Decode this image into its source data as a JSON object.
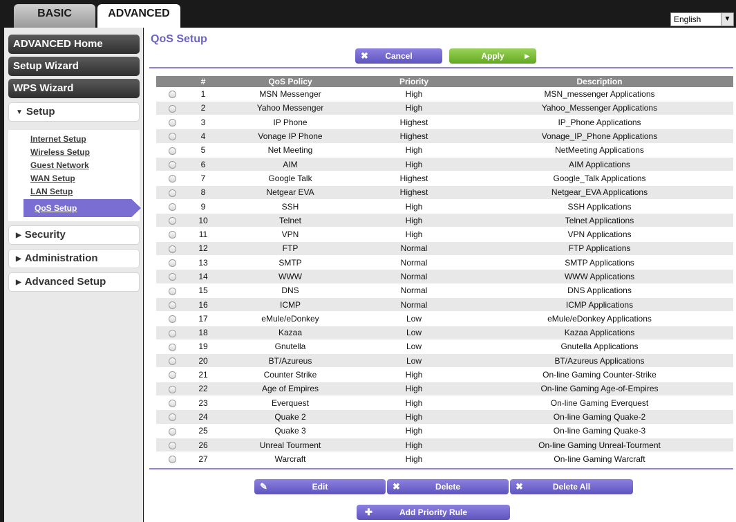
{
  "tabs": {
    "basic": "BASIC",
    "advanced": "ADVANCED"
  },
  "language": {
    "selected": "English"
  },
  "sidebar": {
    "advanced_home": "ADVANCED Home",
    "setup_wizard": "Setup Wizard",
    "wps_wizard": "WPS Wizard",
    "setup": "Setup",
    "setup_links": [
      "Internet Setup",
      "Wireless Setup",
      "Guest Network",
      "WAN Setup",
      "LAN Setup"
    ],
    "qos_setup": "QoS Setup",
    "security": "Security",
    "administration": "Administration",
    "advanced_setup": "Advanced Setup"
  },
  "main": {
    "title": "QoS Setup",
    "cancel": "Cancel",
    "apply": "Apply",
    "edit": "Edit",
    "delete": "Delete",
    "delete_all": "Delete All",
    "add_rule": "Add Priority Rule"
  },
  "table": {
    "headers": [
      "",
      "#",
      "QoS Policy",
      "Priority",
      "Description"
    ],
    "rows": [
      [
        "1",
        "MSN Messenger",
        "High",
        "MSN_messenger Applications"
      ],
      [
        "2",
        "Yahoo Messenger",
        "High",
        "Yahoo_Messenger Applications"
      ],
      [
        "3",
        "IP Phone",
        "Highest",
        "IP_Phone Applications"
      ],
      [
        "4",
        "Vonage IP Phone",
        "Highest",
        "Vonage_IP_Phone Applications"
      ],
      [
        "5",
        "Net Meeting",
        "High",
        "NetMeeting Applications"
      ],
      [
        "6",
        "AIM",
        "High",
        "AIM Applications"
      ],
      [
        "7",
        "Google Talk",
        "Highest",
        "Google_Talk Applications"
      ],
      [
        "8",
        "Netgear EVA",
        "Highest",
        "Netgear_EVA Applications"
      ],
      [
        "9",
        "SSH",
        "High",
        "SSH Applications"
      ],
      [
        "10",
        "Telnet",
        "High",
        "Telnet Applications"
      ],
      [
        "11",
        "VPN",
        "High",
        "VPN Applications"
      ],
      [
        "12",
        "FTP",
        "Normal",
        "FTP Applications"
      ],
      [
        "13",
        "SMTP",
        "Normal",
        "SMTP Applications"
      ],
      [
        "14",
        "WWW",
        "Normal",
        "WWW Applications"
      ],
      [
        "15",
        "DNS",
        "Normal",
        "DNS Applications"
      ],
      [
        "16",
        "ICMP",
        "Normal",
        "ICMP Applications"
      ],
      [
        "17",
        "eMule/eDonkey",
        "Low",
        "eMule/eDonkey Applications"
      ],
      [
        "18",
        "Kazaa",
        "Low",
        "Kazaa Applications"
      ],
      [
        "19",
        "Gnutella",
        "Low",
        "Gnutella Applications"
      ],
      [
        "20",
        "BT/Azureus",
        "Low",
        "BT/Azureus Applications"
      ],
      [
        "21",
        "Counter Strike",
        "High",
        "On-line Gaming Counter-Strike"
      ],
      [
        "22",
        "Age of Empires",
        "High",
        "On-line Gaming Age-of-Empires"
      ],
      [
        "23",
        "Everquest",
        "High",
        "On-line Gaming Everquest"
      ],
      [
        "24",
        "Quake 2",
        "High",
        "On-line Gaming Quake-2"
      ],
      [
        "25",
        "Quake 3",
        "High",
        "On-line Gaming Quake-3"
      ],
      [
        "26",
        "Unreal Tourment",
        "High",
        "On-line Gaming Unreal-Tourment"
      ],
      [
        "27",
        "Warcraft",
        "High",
        "On-line Gaming Warcraft"
      ]
    ]
  }
}
